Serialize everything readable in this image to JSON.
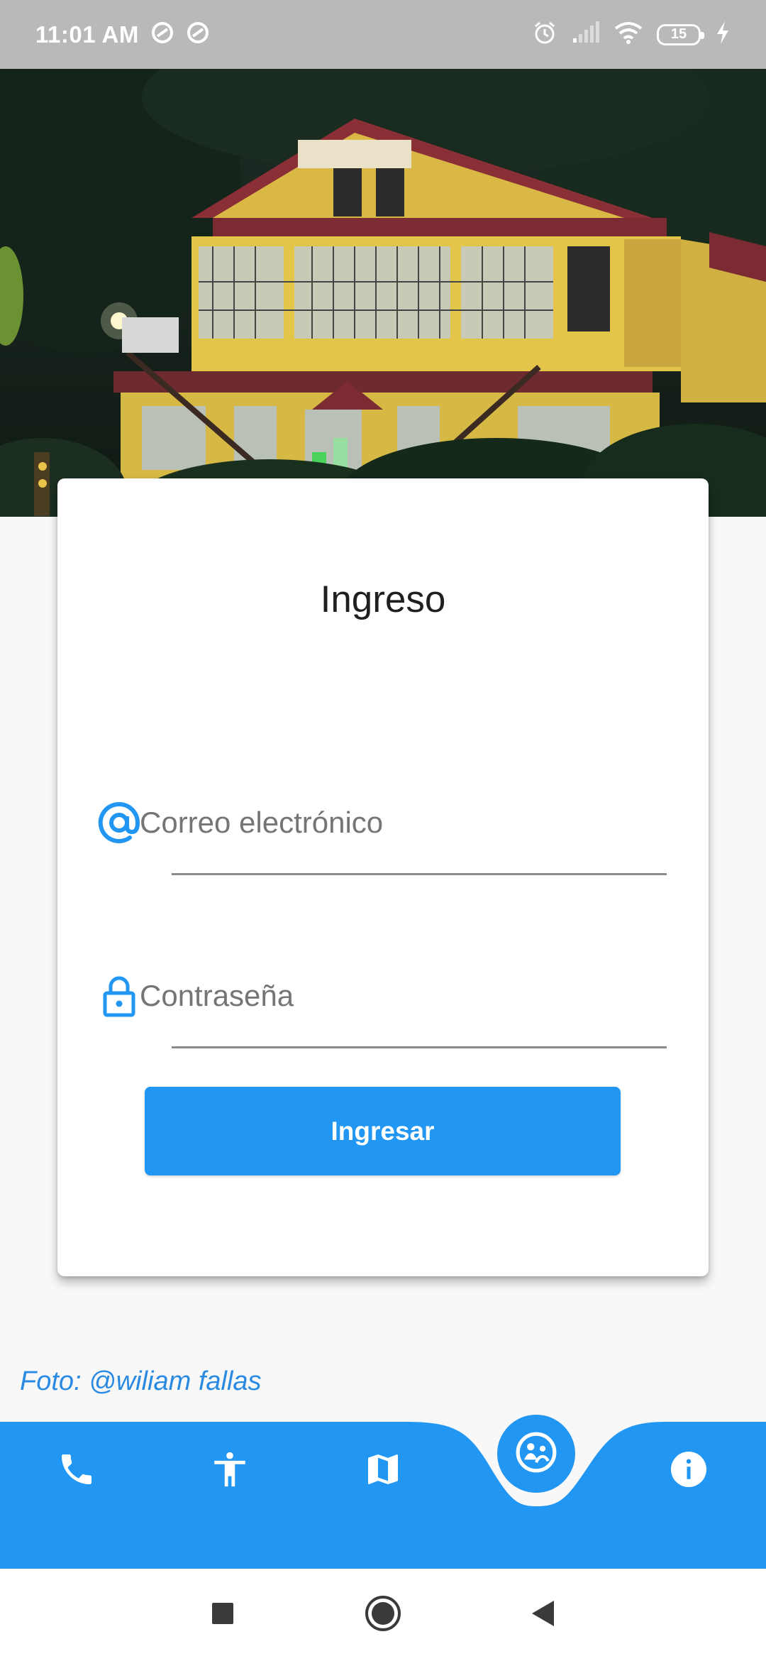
{
  "status_bar": {
    "time": "11:01 AM",
    "battery_level": "15",
    "icons": [
      "vpn-key-icon",
      "vpn-key-icon",
      "alarm-icon",
      "signal-icon",
      "wifi-icon",
      "battery-icon",
      "charging-icon"
    ]
  },
  "hero": {
    "image": "building-photo"
  },
  "login": {
    "title": "Ingreso",
    "email": {
      "placeholder": "Correo electrónico",
      "value": "",
      "icon": "at-sign-icon"
    },
    "password": {
      "placeholder": "Contraseña",
      "value": "",
      "icon": "lock-icon"
    },
    "submit_label": "Ingresar"
  },
  "photo_credit": "Foto: @wiliam fallas",
  "bottom_nav": {
    "items": [
      {
        "icon": "phone-icon"
      },
      {
        "icon": "accessibility-icon"
      },
      {
        "icon": "map-icon"
      },
      {
        "icon": "social-icon",
        "active": true
      },
      {
        "icon": "info-icon"
      }
    ]
  },
  "system_nav": {
    "buttons": [
      "recents-button",
      "home-button",
      "back-button"
    ]
  },
  "colors": {
    "accent": "#2196f3",
    "status_bar": "#b9b9b9",
    "background": "#f8f8f8",
    "credit_text": "#2a8ae2"
  }
}
